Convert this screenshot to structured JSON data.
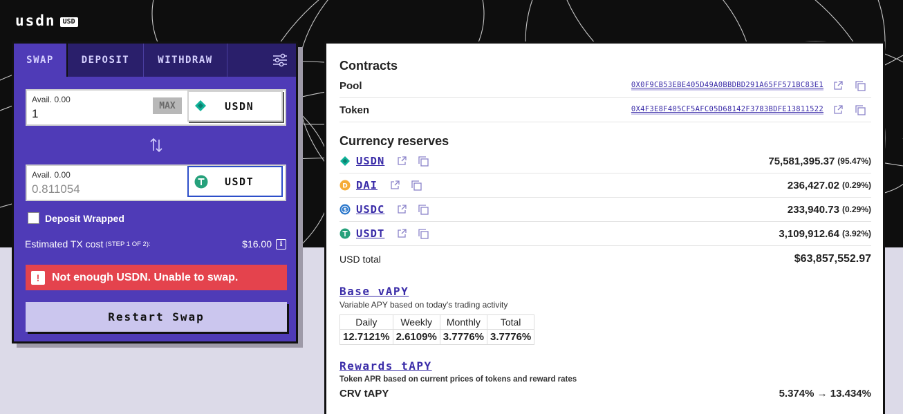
{
  "logo": {
    "text": "usdn",
    "badge": "USD"
  },
  "swap": {
    "tabs": [
      "SWAP",
      "DEPOSIT",
      "WITHDRAW"
    ],
    "from": {
      "avail": "Avail. 0.00",
      "amount": "1",
      "max_label": "MAX",
      "token": "USDN"
    },
    "to": {
      "avail": "Avail. 0.00",
      "amount": "0.811054",
      "token": "USDT"
    },
    "deposit_wrapped_label": "Deposit Wrapped",
    "tx_cost_label": "Estimated TX cost",
    "tx_cost_step": "(STEP 1 OF 2):",
    "tx_cost_value": "$16.00",
    "error": "Not enough USDN. Unable to swap.",
    "restart_label": "Restart Swap"
  },
  "info": {
    "contracts_title": "Contracts",
    "contracts": [
      {
        "label": "Pool",
        "address": "0X0F9CB53EBE405D49A0BBDBD291A65FF571BC83E1"
      },
      {
        "label": "Token",
        "address": "0X4F3E8F405CF5AFC05D68142F3783BDFE13811522"
      }
    ],
    "reserves_title": "Currency reserves",
    "reserves": [
      {
        "name": "USDN",
        "value": "75,581,395.37",
        "pct": "(95.47%)",
        "icon": "usdn-icon",
        "color": "#11b39a"
      },
      {
        "name": "DAI",
        "value": "236,427.02",
        "pct": "(0.29%)",
        "icon": "dai-icon",
        "color": "#f5ac37"
      },
      {
        "name": "USDC",
        "value": "233,940.73",
        "pct": "(0.29%)",
        "icon": "usdc-icon",
        "color": "#2775ca"
      },
      {
        "name": "USDT",
        "value": "3,109,912.64",
        "pct": "(3.92%)",
        "icon": "usdt-icon",
        "color": "#26a17b"
      }
    ],
    "usd_total_label": "USD total",
    "usd_total_value": "$63,857,552.97",
    "base_vapy_title": "Base vAPY",
    "base_vapy_desc": "Variable APY based on today's trading activity",
    "apy_headers": [
      "Daily",
      "Weekly",
      "Monthly",
      "Total"
    ],
    "apy_values": [
      "12.7121%",
      "2.6109%",
      "3.7776%",
      "3.7776%"
    ],
    "rewards_title": "Rewards tAPY",
    "rewards_desc": "Token APR based on current prices of tokens and reward rates",
    "crv_label": "CRV tAPY",
    "crv_value": "5.374% → 13.434%"
  },
  "colors": {
    "panel_purple": "#4f3bb7",
    "error_red": "#e4434d",
    "link_purple": "#3a2ca8"
  }
}
